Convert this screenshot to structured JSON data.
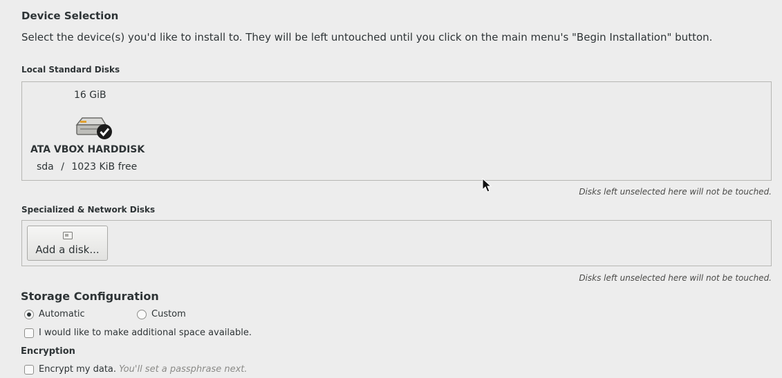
{
  "device_selection": {
    "title": "Device Selection",
    "description": "Select the device(s) you'd like to install to.  They will be left untouched until you click on the main menu's \"Begin Installation\" button."
  },
  "local_disks": {
    "label": "Local Standard Disks",
    "disks": [
      {
        "size": "16 GiB",
        "name": "ATA VBOX HARDDISK",
        "device": "sda",
        "separator": "/",
        "free": "1023 KiB free",
        "selected": true,
        "icon": "harddisk-checked-icon"
      }
    ],
    "hint": "Disks left unselected here will not be touched."
  },
  "network_disks": {
    "label": "Specialized & Network Disks",
    "add_button_label": "Add a disk...",
    "hint": "Disks left unselected here will not be touched."
  },
  "storage_configuration": {
    "title": "Storage Configuration",
    "options": [
      {
        "label": "Automatic",
        "selected": true
      },
      {
        "label": "Custom",
        "selected": false
      }
    ],
    "additional_space_label": "I would like to make additional space available.",
    "additional_space_checked": false
  },
  "encryption": {
    "title": "Encryption",
    "label": "Encrypt my data.",
    "hint": "You'll set a passphrase next.",
    "checked": false
  }
}
